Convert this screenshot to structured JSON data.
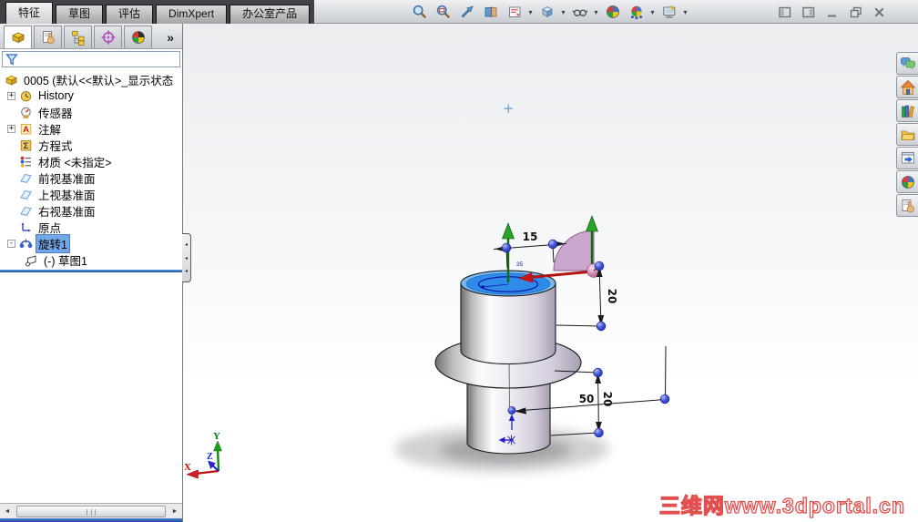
{
  "command_tabs": {
    "items": [
      {
        "label": "特征",
        "active": true
      },
      {
        "label": "草图",
        "active": false
      },
      {
        "label": "评估",
        "active": false
      },
      {
        "label": "DimXpert",
        "active": false
      },
      {
        "label": "办公室产品",
        "active": false
      }
    ]
  },
  "headsup": {
    "caret": "▾",
    "icons": [
      {
        "name": "zoom-to-fit"
      },
      {
        "name": "zoom-to-area"
      },
      {
        "name": "previous-view"
      },
      {
        "name": "section-view"
      },
      {
        "name": "view-orientation",
        "dropdown": true
      },
      {
        "name": "display-style",
        "dropdown": true
      },
      {
        "name": "hide-show-items",
        "dropdown": true
      },
      {
        "name": "edit-appearance"
      },
      {
        "name": "apply-scene",
        "dropdown": true
      },
      {
        "name": "view-settings",
        "dropdown": true
      }
    ]
  },
  "window_controls": {
    "items": [
      "pane-left",
      "pane-right",
      "minimize",
      "restore",
      "close"
    ]
  },
  "feature_panel": {
    "manager_tabs": [
      "featuremanager",
      "propertymanager",
      "configurationmanager",
      "dimxpertmanager",
      "displaymanager"
    ],
    "overflow_glyph": "»",
    "splitter_glyph": "◂",
    "scrollbar": {
      "left_glyph": "◄",
      "right_glyph": "►"
    },
    "tree": {
      "items": [
        {
          "label": "0005 (默认<<默认>_显示状态",
          "icon": "part"
        },
        {
          "label": "History",
          "icon": "history",
          "expand": "+"
        },
        {
          "label": "传感器",
          "icon": "sensors"
        },
        {
          "label": "注解",
          "icon": "annotations",
          "expand": "+"
        },
        {
          "label": "方程式",
          "icon": "equations"
        },
        {
          "label": "材质 <未指定>",
          "icon": "material"
        },
        {
          "label": "前视基准面",
          "icon": "plane"
        },
        {
          "label": "上视基准面",
          "icon": "plane"
        },
        {
          "label": "右视基准面",
          "icon": "plane"
        },
        {
          "label": "原点",
          "icon": "origin"
        },
        {
          "label": "旋转1",
          "icon": "revolve",
          "expand": "-",
          "selected": true
        },
        {
          "label": "(-) 草图1",
          "icon": "sketch"
        }
      ]
    }
  },
  "viewport": {
    "cursor_glyph": "+",
    "dims": {
      "top_width": "15",
      "neck_height": "20",
      "base_height": "50",
      "base_height2": "20",
      "sketch": "35"
    },
    "triad": {
      "x": "X",
      "y": "Y",
      "z": "Z"
    },
    "watermark": "三维网www.3dportal.cn"
  },
  "task_pane": {
    "icons": [
      "forum",
      "home-resources",
      "design-library",
      "file-explorer",
      "view-palette",
      "appearances-scenes",
      "custom-properties"
    ]
  },
  "colors": {
    "selection": "#74a7e8",
    "rollback_bar": "#2b5fae",
    "top_face_blue": "#2e8ce8",
    "handle_point_blue": "#2233cc",
    "watermark_red": "#e14f4f",
    "dimension_text": "#111111"
  }
}
